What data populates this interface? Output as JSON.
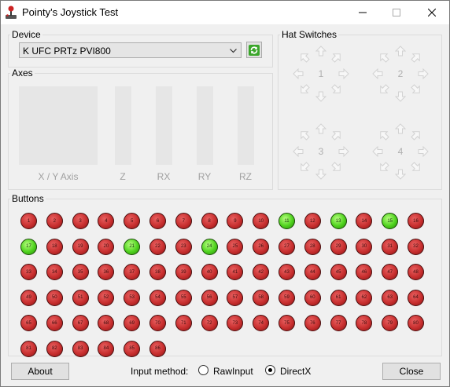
{
  "window": {
    "title": "Pointy's Joystick Test",
    "minimize_icon": "minimize-icon",
    "maximize_icon": "maximize-icon",
    "close_icon": "close-icon"
  },
  "device": {
    "legend": "Device",
    "selected": "K UFC PRTz PVI800",
    "refresh_icon": "refresh-icon"
  },
  "axes": {
    "legend": "Axes",
    "labels": [
      "X / Y Axis",
      "Z",
      "RX",
      "RY",
      "RZ"
    ]
  },
  "hats": {
    "legend": "Hat Switches",
    "numbers": [
      "1",
      "2",
      "3",
      "4"
    ]
  },
  "buttons": {
    "legend": "Buttons",
    "labels": [
      "1",
      "2",
      "3",
      "4",
      "5",
      "6",
      "7",
      "8",
      "9",
      "10",
      "11",
      "12",
      "13",
      "14",
      "15",
      "16",
      "17",
      "18",
      "19",
      "20",
      "21",
      "22",
      "23",
      "24",
      "25",
      "26",
      "27",
      "28",
      "29",
      "30",
      "31",
      "32",
      "33",
      "34",
      "35",
      "36",
      "37",
      "38",
      "39",
      "40",
      "41",
      "42",
      "43",
      "44",
      "45",
      "46",
      "47",
      "48",
      "49",
      "50",
      "51",
      "52",
      "53",
      "54",
      "55",
      "56",
      "57",
      "58",
      "59",
      "60",
      "61",
      "62",
      "63",
      "64",
      "65",
      "66",
      "67",
      "68",
      "69",
      "70",
      "71",
      "72",
      "73",
      "74",
      "75",
      "76",
      "77",
      "78",
      "79",
      "80",
      "81",
      "82",
      "83",
      "84",
      "85",
      "86"
    ],
    "pressed": [
      "11",
      "13",
      "15",
      "17",
      "21",
      "24"
    ],
    "pressed_color": "#4fd21e",
    "released_color": "#c82f2f"
  },
  "footer": {
    "about": "About",
    "input_method_label": "Input method:",
    "options": [
      "RawInput",
      "DirectX"
    ],
    "selected": "DirectX",
    "close": "Close"
  }
}
